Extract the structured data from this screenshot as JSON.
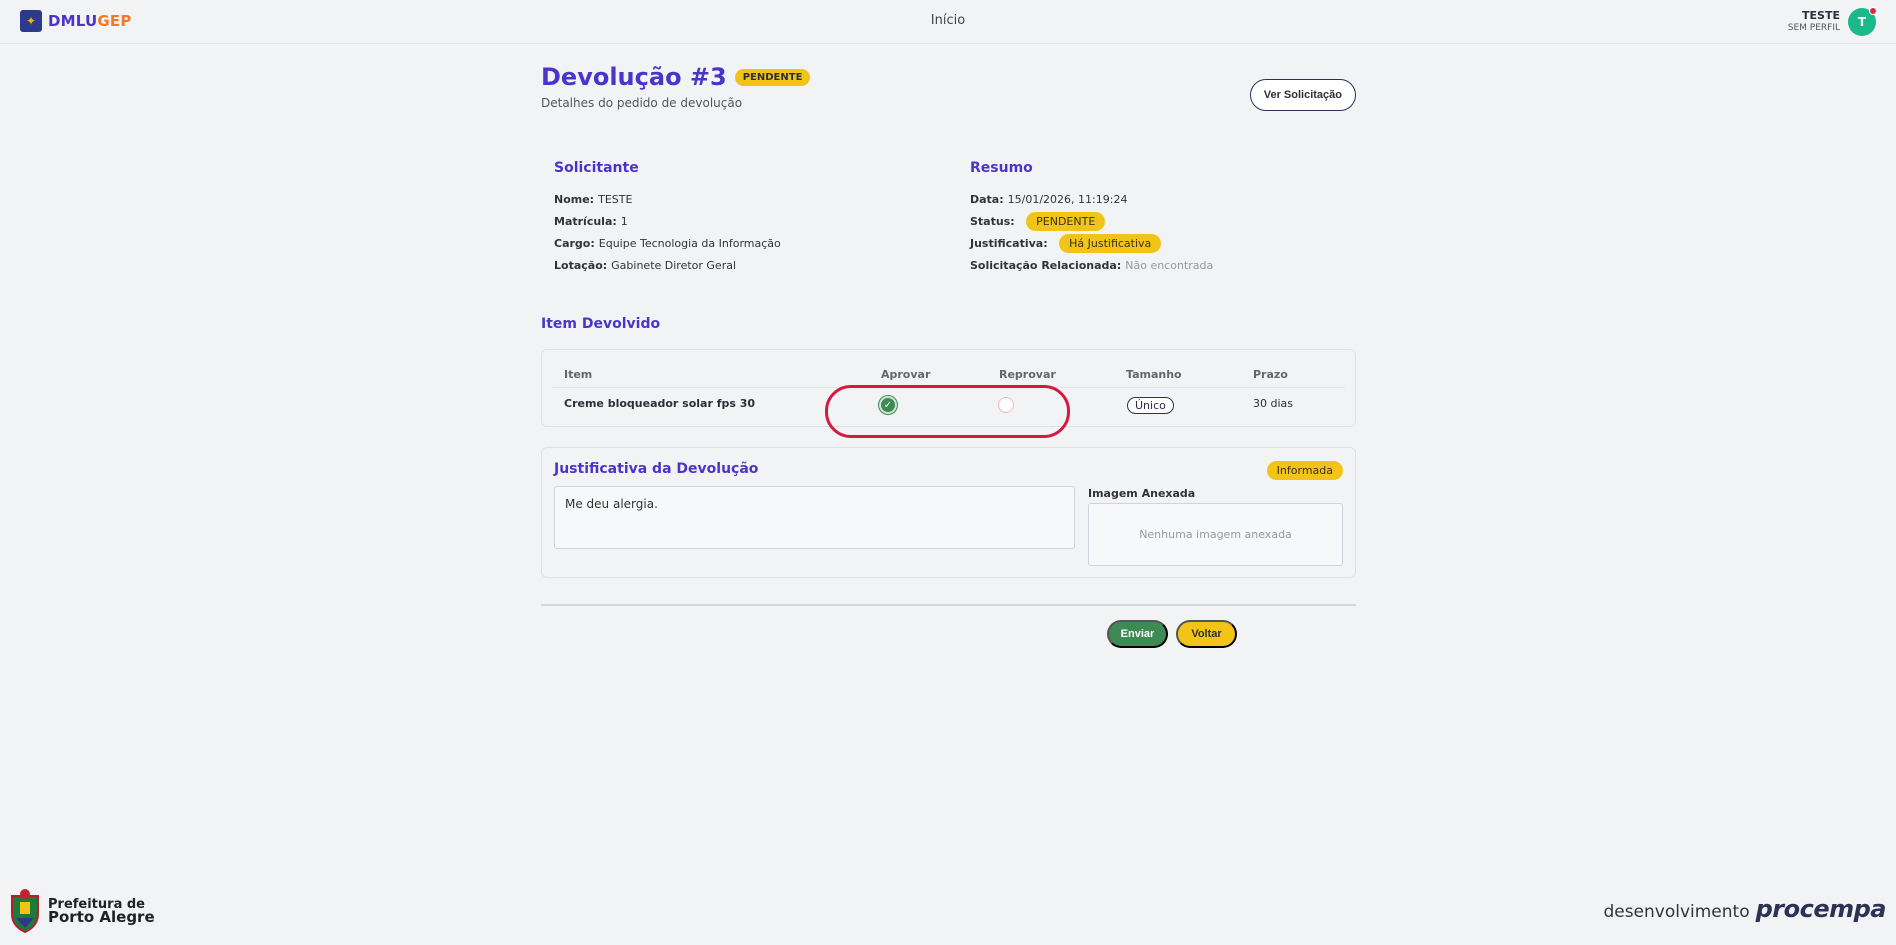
{
  "header": {
    "logo_part1": "DMLU",
    "logo_part2": "GEP",
    "nav_home": "Início",
    "user_name": "TESTE",
    "user_role": "SEM PERFIL",
    "avatar_initial": "T"
  },
  "page": {
    "title": "Devolução #3",
    "status_badge": "PENDENTE",
    "subtitle": "Detalhes do pedido de devolução",
    "view_request_button": "Ver Solicitação"
  },
  "requester": {
    "heading": "Solicitante",
    "name_label": "Nome:",
    "name_value": "TESTE",
    "id_label": "Matrícula:",
    "id_value": "1",
    "role_label": "Cargo:",
    "role_value": "Equipe Tecnologia da Informação",
    "location_label": "Lotação:",
    "location_value": "Gabinete Diretor Geral"
  },
  "summary": {
    "heading": "Resumo",
    "date_label": "Data:",
    "date_value": "15/01/2026, 11:19:24",
    "status_label": "Status:",
    "status_value": "PENDENTE",
    "justification_label": "Justificativa:",
    "justification_value": "Há Justificativa",
    "related_label": "Solicitação Relacionada:",
    "related_value": "Não encontrada"
  },
  "items": {
    "heading": "Item Devolvido",
    "columns": [
      "Item",
      "Aprovar",
      "Reprovar",
      "Tamanho",
      "Prazo"
    ],
    "rows": [
      {
        "item": "Creme bloqueador solar fps 30",
        "approve": true,
        "reject": false,
        "size": "Único",
        "deadline": "30 dias"
      }
    ]
  },
  "justification": {
    "heading": "Justificativa da Devolução",
    "badge": "Informada",
    "text": "Me deu alergia.",
    "image_label": "Imagem Anexada",
    "image_placeholder": "Nenhuma imagem anexada"
  },
  "actions": {
    "send": "Enviar",
    "back": "Voltar"
  },
  "footer": {
    "city_line1": "Prefeitura de",
    "city_line2": "Porto Alegre",
    "dev_text": "desenvolvimento",
    "brand": "procempa"
  },
  "colors": {
    "primary": "#4b35c9",
    "accent_yellow": "#f2c417",
    "success": "#3d8a55",
    "highlight_red": "#d7193f"
  }
}
